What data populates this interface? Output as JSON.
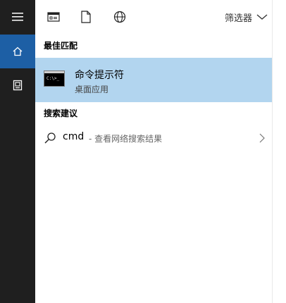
{
  "toolbar": {
    "filter_label": "筛选器"
  },
  "sections": {
    "best_match_title": "最佳匹配",
    "suggestions_title": "搜索建议"
  },
  "best_match": {
    "title": "命令提示符",
    "subtitle": "桌面应用",
    "thumb_prompt": "C:\\>_"
  },
  "suggestion": {
    "query": "cmd",
    "hint": "- 查看网络搜索结果"
  },
  "colors": {
    "rail": "#1f1f1f",
    "rail_active": "#1d5fa5",
    "selection": "#b2d5ef"
  },
  "icons": {
    "menu": "hamburger-icon",
    "home": "home-icon",
    "docs_rail": "document-icon",
    "apps": "apps-icon",
    "documents": "document-icon",
    "web": "globe-icon",
    "search": "search-icon",
    "chevron": "chevron-right-icon",
    "filter_chevron": "chevron-down-icon"
  }
}
